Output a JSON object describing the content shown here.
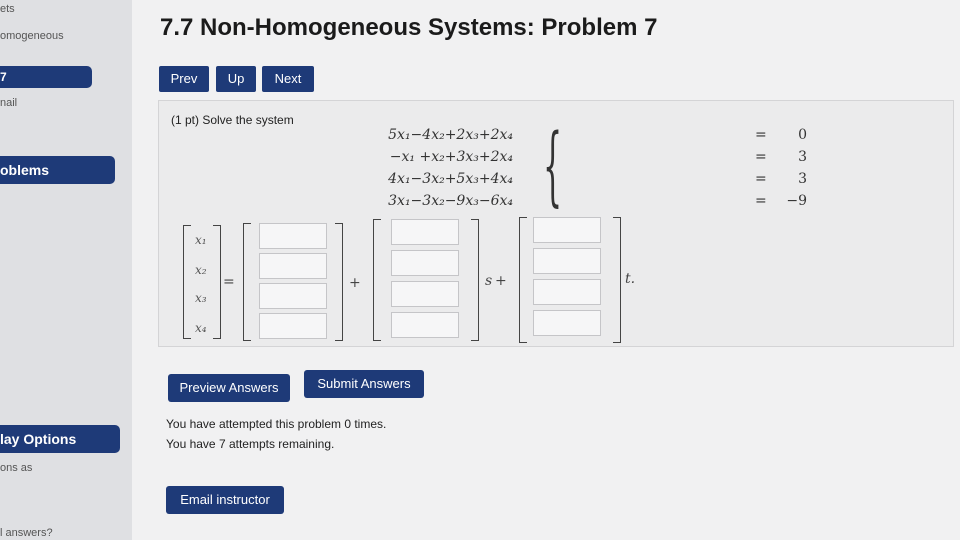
{
  "sidebar": {
    "item_top": "ets",
    "item_homogeneous": "omogeneous",
    "item_problem": "7",
    "item_email": "nail",
    "item_problems": "oblems",
    "item_display_options": "lay Options",
    "item_show_as": "ons as",
    "item_answers": "l answers?"
  },
  "page": {
    "title": "7.7 Non-Homogeneous Systems: Problem 7"
  },
  "nav": {
    "prev": "Prev",
    "up": "Up",
    "next": "Next"
  },
  "problem": {
    "prompt": "(1 pt) Solve the system",
    "equations": [
      {
        "lhs": "5x₁−4x₂+2x₃+2x₄",
        "op": "=",
        "rhs": "0"
      },
      {
        "lhs": "−x₁  +x₂+3x₃+2x₄",
        "op": "=",
        "rhs": "3"
      },
      {
        "lhs": "4x₁−3x₂+5x₃+4x₄",
        "op": "=",
        "rhs": "3"
      },
      {
        "lhs": "3x₁−3x₂−9x₃−6x₄",
        "op": "=",
        "rhs": "−9"
      }
    ],
    "vars": [
      "x₁",
      "x₂",
      "x₃",
      "x₄"
    ],
    "equals": "=",
    "plus1": "+",
    "param_s": "s",
    "plus2": "+",
    "param_t": "t."
  },
  "actions": {
    "preview": "Preview Answers",
    "submit": "Submit Answers",
    "email": "Email instructor"
  },
  "status": {
    "attempted": "You have attempted this problem 0 times.",
    "remaining": "You have 7 attempts remaining."
  }
}
